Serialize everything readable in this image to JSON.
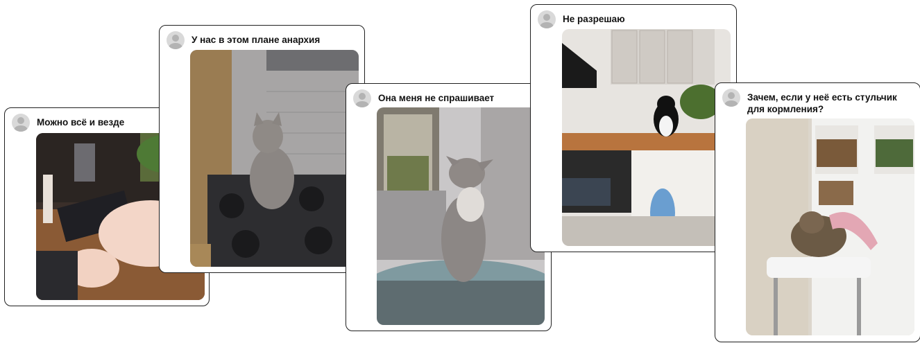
{
  "posts": [
    {
      "caption": "Можно всё и везде",
      "photo_icon": "white-cat-lying-on-desk"
    },
    {
      "caption": "У нас в этом плане анархия",
      "photo_icon": "gray-cat-on-stove"
    },
    {
      "caption": "Она меня не спрашивает",
      "photo_icon": "gray-cat-on-glass-table"
    },
    {
      "caption": "Не разрешаю",
      "photo_icon": "black-white-cat-on-kitchen-counter"
    },
    {
      "caption": "Зачем, если у неё есть стульчик для кормления?",
      "photo_icon": "cat-in-high-chair"
    }
  ],
  "colors": {
    "card_border": "#1f1f1f",
    "card_background": "#ffffff",
    "avatar": "#d9d9d9"
  }
}
